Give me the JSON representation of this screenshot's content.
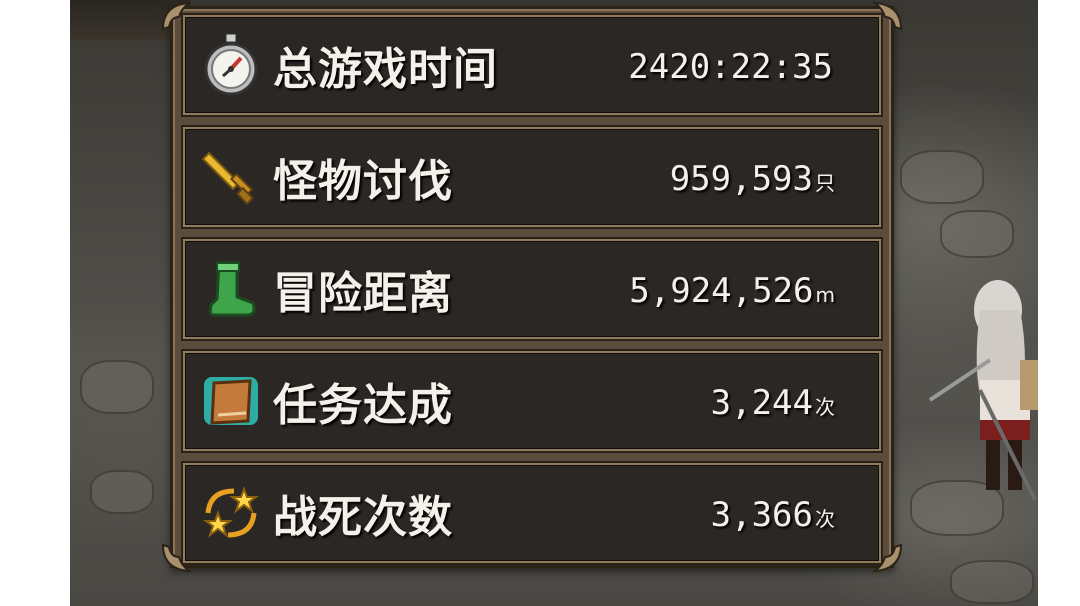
{
  "stats": [
    {
      "label": "总游戏时间",
      "value": "2420:22:35",
      "unit": "",
      "icon": "stopwatch-icon"
    },
    {
      "label": "怪物讨伐",
      "value": "959,593",
      "unit": "只",
      "icon": "sword-icon"
    },
    {
      "label": "冒险距离",
      "value": "5,924,526",
      "unit": "m",
      "icon": "boot-icon"
    },
    {
      "label": "任务达成",
      "value": "3,244",
      "unit": "次",
      "icon": "book-icon"
    },
    {
      "label": "战死次数",
      "value": "3,366",
      "unit": "次",
      "icon": "stars-icon"
    }
  ],
  "colors": {
    "frame": "#5b4c3c",
    "frame_border": "#8f7a5a",
    "row_bg": "#1e1e1e",
    "text": "#f4f1ea"
  }
}
